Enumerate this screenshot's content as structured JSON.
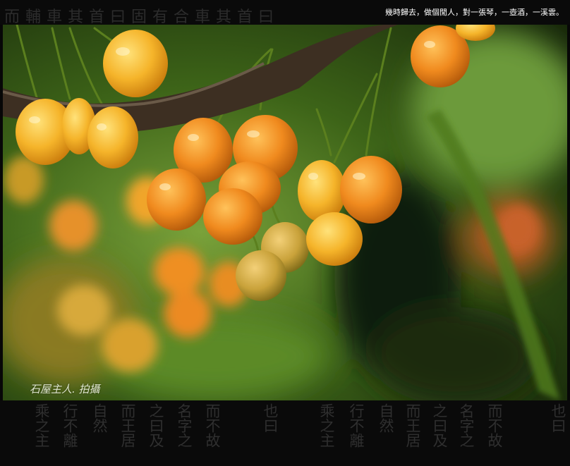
{
  "poem": "幾時歸去，做個閒人，對一張琴，一壺酒，一溪雲。",
  "credit": "石屋主人. 拍攝",
  "decor": {
    "top_calligraphy": "而輔車其首曰固有合車其首曰",
    "bottom_columns": [
      "也曰",
      "而不故",
      "名字之",
      "之曰及",
      "而王居",
      "自然",
      "行不離",
      "乘之主",
      "也曰",
      "而不故",
      "名字之",
      "之曰及",
      "而王居",
      "自然",
      "行不離",
      "乘之主"
    ]
  },
  "colors": {
    "frame": "#070707",
    "cherry_yellow": "#f5b42a",
    "cherry_orange": "#f08a1e",
    "leaf_green": "#4f7a1e"
  }
}
